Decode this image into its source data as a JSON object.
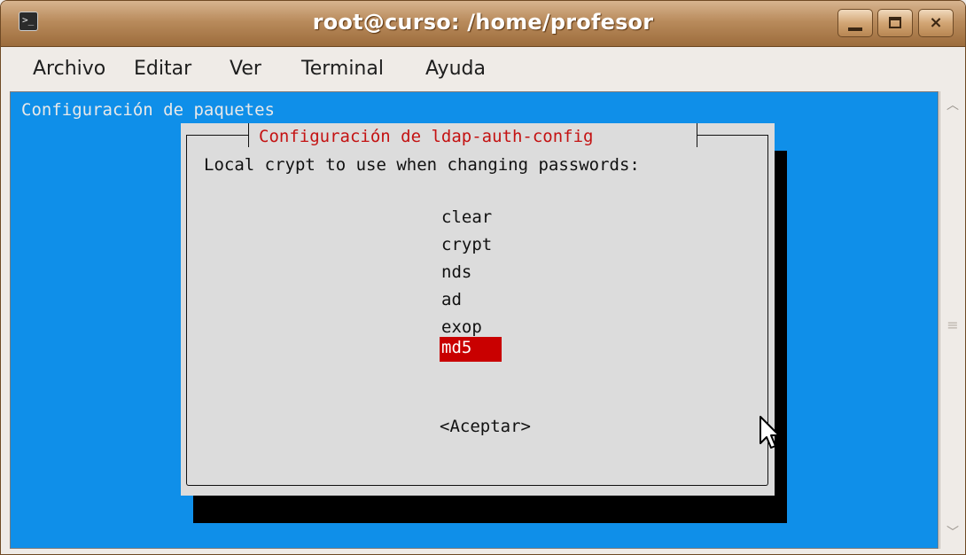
{
  "window": {
    "title": "root@curso: /home/profesor",
    "controls": {
      "minimize": "minimize",
      "maximize": "maximize",
      "close": "×"
    }
  },
  "menubar": {
    "items": [
      {
        "label": "Archivo"
      },
      {
        "label": "Editar"
      },
      {
        "label": "Ver"
      },
      {
        "label": "Terminal"
      },
      {
        "label": "Ayuda"
      }
    ]
  },
  "terminal": {
    "header": "Configuración de paquetes",
    "dialog": {
      "title": "Configuración de ldap-auth-config",
      "prompt": "Local crypt to use when changing passwords:",
      "options": [
        "clear",
        "crypt",
        "nds",
        "ad",
        "exop",
        "md5"
      ],
      "selected": "md5",
      "accept_button": "<Aceptar>"
    },
    "colors": {
      "background": "#0f8fe9",
      "dialog_bg": "#dcdcdc",
      "title_text": "#c41212",
      "selection_bg": "#c90000"
    }
  },
  "icons": {
    "app": "terminal-icon",
    "cursor": "mouse-pointer-icon",
    "scroll_up": "scroll-up-arrow-icon",
    "scroll_down": "scroll-down-arrow-icon",
    "scroll_grip": "scroll-grip-icon"
  }
}
